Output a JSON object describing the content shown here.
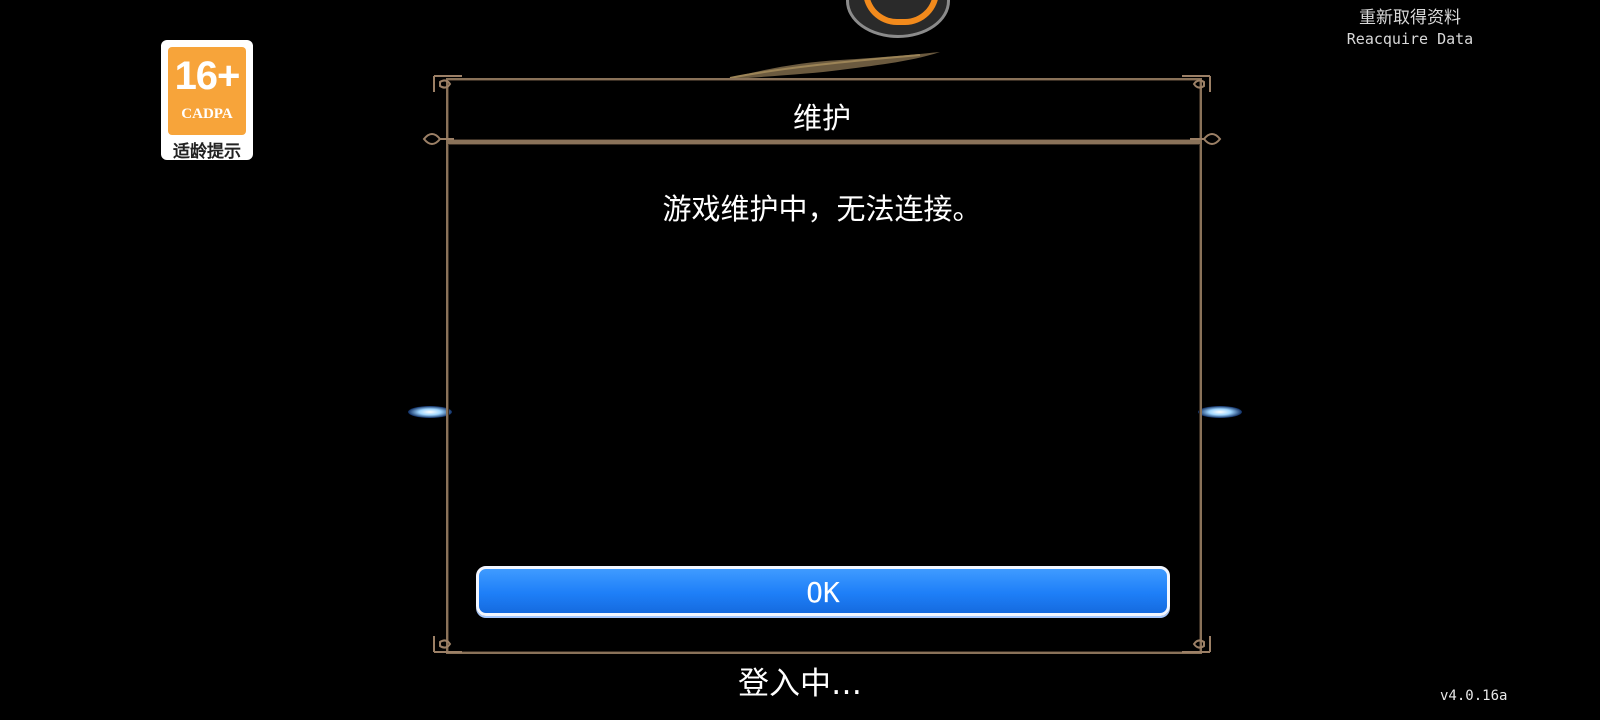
{
  "age_rating": {
    "label": "16+",
    "org": "CADPA",
    "hint": "适龄提示"
  },
  "reacquire": {
    "label_zh": "重新取得资料",
    "label_en": "Reacquire Data"
  },
  "dialog": {
    "title": "维护",
    "message": "游戏维护中，无法连接。",
    "ok_label": "OK"
  },
  "status": {
    "loading": "登入中…"
  },
  "version": "v4.0.16a",
  "colors": {
    "button_blue": "#1e7ff8",
    "frame_bronze": "#8a7259",
    "badge_orange": "#f7a43a",
    "background": "#000000"
  },
  "icons": [
    "game-emblem-icon",
    "wing-ornament-icon",
    "frame-corner-ornament-icon",
    "glow-indicator-icon"
  ]
}
